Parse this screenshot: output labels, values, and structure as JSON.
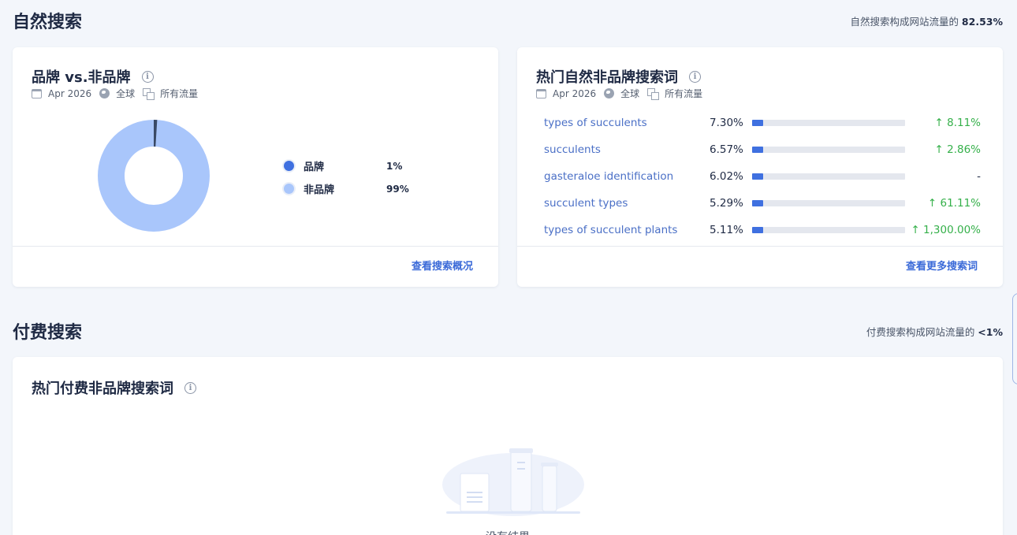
{
  "organic": {
    "title": "自然搜索",
    "note_prefix": "自然搜索构成网站流量的 ",
    "note_value": "82.53%"
  },
  "brand_card": {
    "title": "品牌 vs.非品牌",
    "meta": {
      "date": "Apr 2026",
      "region": "全球",
      "traffic": "所有流量"
    },
    "donut": {
      "branded_fraction": 0.01,
      "non_branded_fraction": 0.99
    },
    "legend": [
      {
        "label": "品牌",
        "value": "1%",
        "color": "#3f70e0"
      },
      {
        "label": "非品牌",
        "value": "99%",
        "color": "#a9c6fb"
      }
    ],
    "link": "查看搜索概况"
  },
  "keywords_card": {
    "title": "热门自然非品牌搜索词",
    "meta": {
      "date": "Apr 2026",
      "region": "全球",
      "traffic": "所有流量"
    },
    "rows": [
      {
        "term": "types of succulents",
        "share": "7.30%",
        "share_fraction": 0.073,
        "change": "↑ 8.11%"
      },
      {
        "term": "succulents",
        "share": "6.57%",
        "share_fraction": 0.0657,
        "change": "↑ 2.86%"
      },
      {
        "term": "gasteraloe identification",
        "share": "6.02%",
        "share_fraction": 0.0602,
        "change": "-"
      },
      {
        "term": "succulent types",
        "share": "5.29%",
        "share_fraction": 0.0529,
        "change": "↑ 61.11%"
      },
      {
        "term": "types of succulent plants",
        "share": "5.11%",
        "share_fraction": 0.0511,
        "change": "↑ 1,300.00%"
      }
    ],
    "link": "查看更多搜索词"
  },
  "paid": {
    "title": "付费搜索",
    "note_prefix": "付费搜索构成网站流量的 ",
    "note_value": "<1%"
  },
  "paid_card": {
    "title": "热门付费非品牌搜索词",
    "empty_text": "没有结果"
  }
}
